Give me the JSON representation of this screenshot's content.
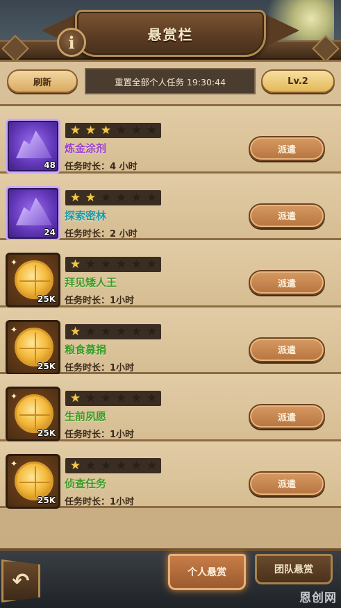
{
  "header": {
    "title": "悬赏栏",
    "info_glyph": "i"
  },
  "toolbar": {
    "refresh_label": "刷新",
    "reset_text": "重置全部个人任务 19:30:44",
    "level_label": "Lv.2"
  },
  "tasks": [
    {
      "name": "炼金涂剂",
      "duration": "任务时长：4 小时",
      "stars": 3,
      "max_stars": 6,
      "reward_icon": "purple-crystal-icon",
      "reward_count": "48",
      "name_color": "#9a3fd1",
      "dispatch_label": "派遣"
    },
    {
      "name": "探索密林",
      "duration": "任务时长：2 小时",
      "stars": 2,
      "max_stars": 6,
      "reward_icon": "purple-crystal-icon",
      "reward_count": "24",
      "name_color": "#1d9aa5",
      "dispatch_label": "派遣"
    },
    {
      "name": "拜见矮人王",
      "duration": "任务时长：1小时",
      "stars": 1,
      "max_stars": 6,
      "reward_icon": "gold-coin-icon",
      "reward_count": "25K",
      "name_color": "#3a9a22",
      "dispatch_label": "派遣"
    },
    {
      "name": "粮食募捐",
      "duration": "任务时长：1小时",
      "stars": 1,
      "max_stars": 6,
      "reward_icon": "gold-coin-icon",
      "reward_count": "25K",
      "name_color": "#3a9a22",
      "dispatch_label": "派遣"
    },
    {
      "name": "生前夙愿",
      "duration": "任务时长：1小时",
      "stars": 1,
      "max_stars": 6,
      "reward_icon": "gold-coin-icon",
      "reward_count": "25K",
      "name_color": "#3a9a22",
      "dispatch_label": "派遣"
    },
    {
      "name": "侦查任务",
      "duration": "任务时长：1小时",
      "stars": 1,
      "max_stars": 6,
      "reward_icon": "gold-coin-icon",
      "reward_count": "25K",
      "name_color": "#3a9a22",
      "dispatch_label": "派遣"
    }
  ],
  "bottom_tabs": {
    "personal_label": "个人悬赏",
    "team_label": "团队悬赏",
    "active": "personal"
  },
  "watermark": "恩创网",
  "colors": {
    "parchment": "#d6bd92",
    "wood": "#5a3b22",
    "star_on": "#f2c744",
    "dispatch_button": "#c88a52"
  }
}
